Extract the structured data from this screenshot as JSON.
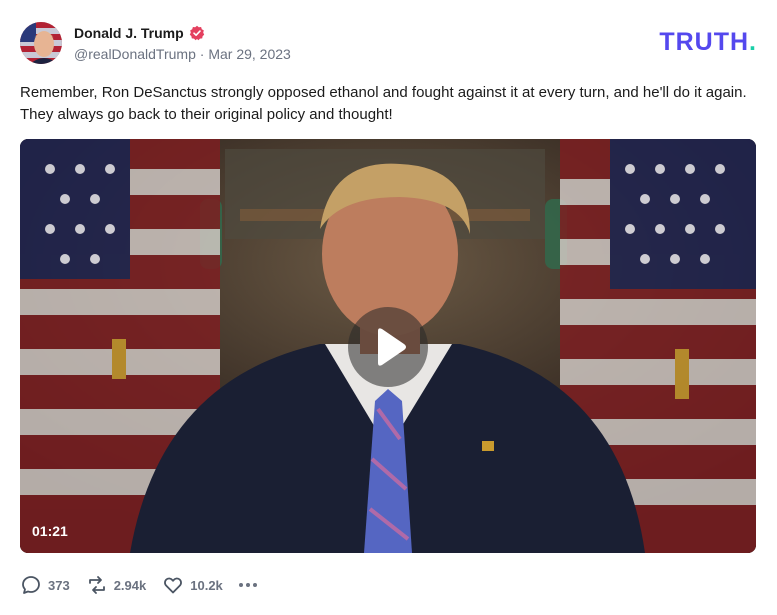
{
  "post": {
    "author": {
      "display_name": "Donald J. Trump",
      "handle": "@realDonaldTrump",
      "date": "Mar 29, 2023",
      "verified": true
    },
    "brand": {
      "logo_text": "TRUTH",
      "logo_dot": ".",
      "accent": "#5448ee",
      "dot_color": "#19cfa8"
    },
    "text": "Remember, Ron DeSanctus strongly opposed ethanol and fought against it at every turn, and he'll do it again. They always go back to their original policy and thought!",
    "media": {
      "type": "video",
      "duration": "01:21",
      "icon": "play-icon"
    },
    "stats": {
      "replies": "373",
      "retruths": "2.94k",
      "likes": "10.2k"
    }
  }
}
